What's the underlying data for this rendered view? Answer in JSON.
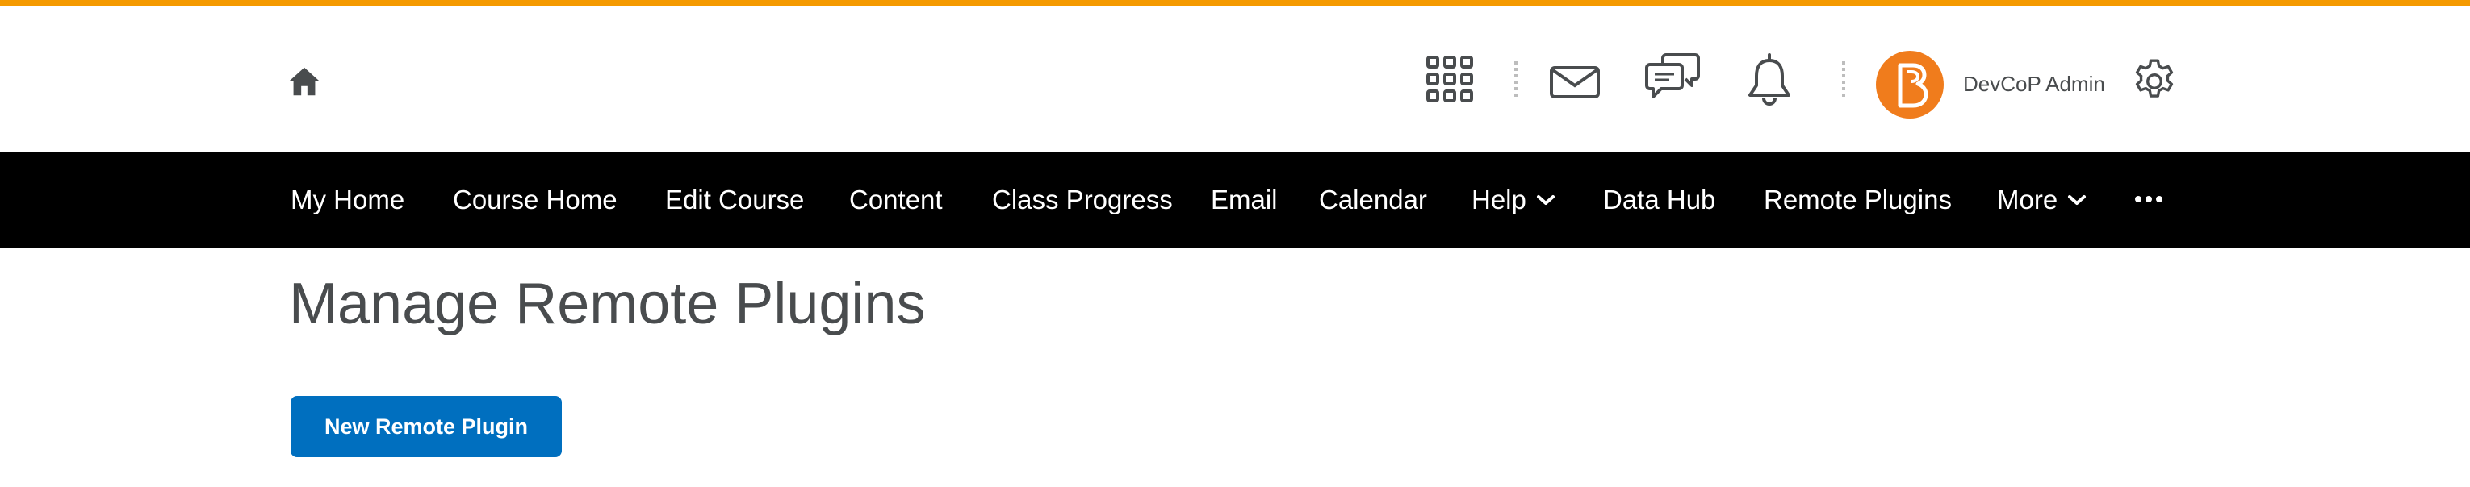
{
  "theme": {
    "accent": "#f59a00",
    "nav_bg": "#000000",
    "primary": "#006fbf",
    "avatar_bg": "#f07c1c",
    "text": "#494c4e"
  },
  "header": {
    "icons": [
      "home-icon",
      "app-grid-icon",
      "envelope-icon",
      "chat-bubbles-icon",
      "bell-icon",
      "gear-icon"
    ],
    "user": {
      "name": "DevCoP Admin",
      "avatar_icon": "brightspace-logo-icon"
    }
  },
  "nav": {
    "items": [
      {
        "label": "My Home"
      },
      {
        "label": "Course Home"
      },
      {
        "label": "Edit Course"
      },
      {
        "label": "Content"
      },
      {
        "label": "Class Progress"
      },
      {
        "label": "Email"
      },
      {
        "label": "Calendar"
      },
      {
        "label": "Help",
        "dropdown": true
      },
      {
        "label": "Data Hub"
      },
      {
        "label": "Remote Plugins"
      },
      {
        "label": "More",
        "dropdown": true
      }
    ],
    "overflow_icon": "ellipsis-icon"
  },
  "main": {
    "title": "Manage Remote Plugins",
    "new_button_label": "New Remote Plugin"
  }
}
